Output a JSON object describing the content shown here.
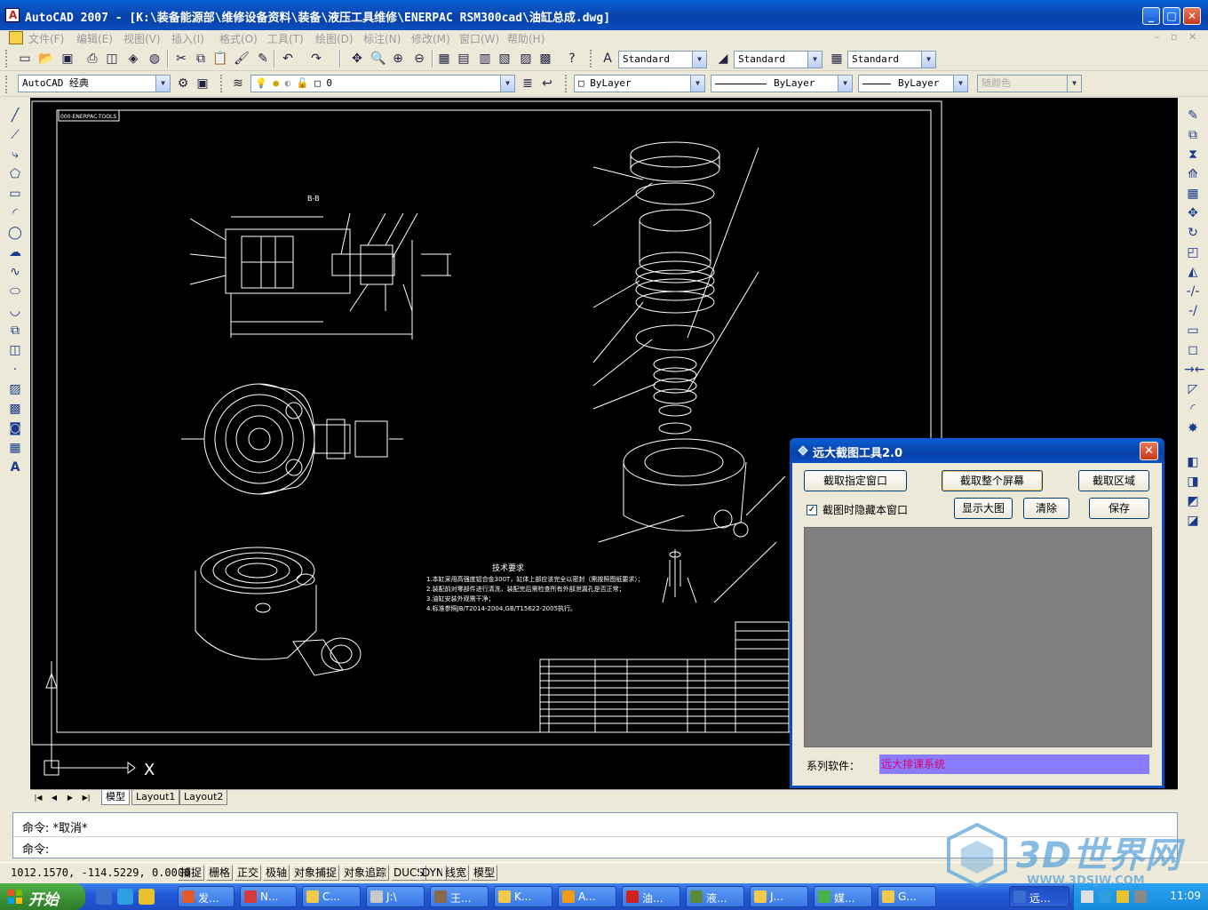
{
  "window": {
    "title": "AutoCAD 2007 - [K:\\装备能源部\\维修设备资料\\装备\\液压工具维修\\ENERPAC RSM300cad\\油缸总成.dwg]"
  },
  "menu": {
    "items": [
      "文件(F)",
      "编辑(E)",
      "视图(V)",
      "插入(I)",
      "格式(O)",
      "工具(T)",
      "绘图(D)",
      "标注(N)",
      "修改(M)",
      "窗口(W)",
      "帮助(H)"
    ]
  },
  "toolbar": {
    "text_style": "Standard",
    "dim_style": "Standard",
    "table_style": "Standard",
    "workspace": "AutoCAD 经典",
    "layer": "0",
    "color": "ByLayer",
    "linetype": "ByLayer",
    "lineweight": "ByLayer",
    "plot_style": "随颜色"
  },
  "drawing": {
    "section_label": "B-B",
    "tech_title": "技术要求",
    "tech_notes": [
      "1.本缸采用高强度铝合金300T，缸体上部应该完全以密封（需按照图纸要求）；",
      "2.装配前对零部件进行清洗，装配完后需检查所有外部泄漏孔是否正常；",
      "3.油缸安装外观需干净；",
      "4.标准参照JB/T2014-2004,GB/T15622-2005执行。"
    ],
    "title_block_code": "000-ENERPAC-TOOLS",
    "x_axis": "X"
  },
  "tabs": {
    "model": "模型",
    "layout1": "Layout1",
    "layout2": "Layout2"
  },
  "command": {
    "history": "命令: *取消*",
    "prompt": "命令:"
  },
  "status": {
    "coords": "1012.1570, -114.5229, 0.0000",
    "toggles": [
      "捕捉",
      "栅格",
      "正交",
      "极轴",
      "对象捕捉",
      "对象追踪",
      "DUCS",
      "DYN",
      "线宽",
      "模型"
    ]
  },
  "popup": {
    "title": "远大截图工具2.0",
    "btn_capture_window": "截取指定窗口",
    "btn_capture_screen": "截取整个屏幕",
    "btn_capture_region": "截取区域",
    "hide_label": "截图时隐藏本窗口",
    "hide_checked": "✓",
    "btn_show_large": "显示大图",
    "btn_clear": "清除",
    "btn_save": "保存",
    "series_label": "系列软件：",
    "series_value": "远大排课系统"
  },
  "taskbar": {
    "start": "开始",
    "tasks": [
      "发...",
      "N...",
      "C...",
      "J:\\",
      "王...",
      "K...",
      "A...",
      "油...",
      "液...",
      "J...",
      "媒...",
      "G..."
    ],
    "active_task": "远...",
    "clock": "11:09"
  },
  "watermark": {
    "text": "3D世界网",
    "url": "WWW.3DSJW.COM"
  }
}
